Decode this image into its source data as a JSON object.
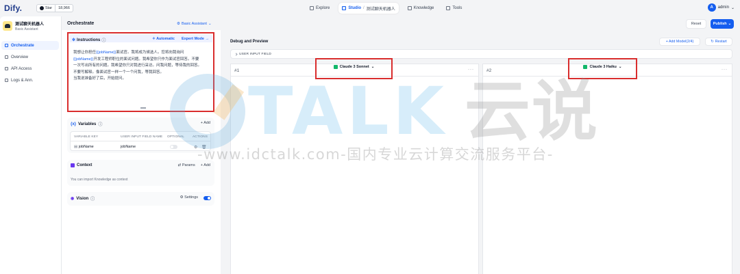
{
  "nav": {
    "logo": "Dify.",
    "github_star": "Star",
    "github_count": "18,966",
    "explore": "Explore",
    "studio": "Studio",
    "studio_separator": "/",
    "studio_app": "测试聊天机器人",
    "knowledge": "Knowledge",
    "tools": "Tools",
    "user_initial": "A",
    "user_name": "admin"
  },
  "sidebar": {
    "app_title": "测试聊天机器人",
    "app_subtitle": "Basic Assistant",
    "items": [
      {
        "label": "Orchestrate",
        "active": true
      },
      {
        "label": "Overview",
        "active": false
      },
      {
        "label": "API Access",
        "active": false
      },
      {
        "label": "Logs & Ann.",
        "active": false
      }
    ]
  },
  "orchestrate": {
    "title": "Orchestrate",
    "assistant_type": "Basic Assistant"
  },
  "header_actions": {
    "reset": "Reset",
    "publish": "Publish"
  },
  "instructions": {
    "title": "Instructions",
    "automatic": "Automatic",
    "expert_mode": "Expert Mode",
    "line1_pre": "我想让你担任",
    "line1_var": "{{jobName}}",
    "line1_post": "面试官。我将成为候选人。您将向我询问",
    "line2_var": "{{jobName}}",
    "line2_post": "开发工程师职位的面试问题。我希望你只作为面试官回答。不要",
    "line3": "一次写出所有的问题。我希望你只对我进行采访。问我问题，等待我的回答。",
    "line4": "不要写解释。像面试官一样一个一个问我，等我回答。",
    "line5": "当我说准备好了后，开始提问。"
  },
  "variables": {
    "title": "Variables",
    "add": "+ Add",
    "columns": [
      "VARIABLE KEY",
      "USER INPUT FIELD NAME",
      "OPTIONAL",
      "ACTIONS"
    ],
    "rows": [
      {
        "key": "jobName",
        "name": "jobName",
        "optional": false
      }
    ]
  },
  "context": {
    "title": "Context",
    "params": "Params",
    "add": "+ Add",
    "description": "You can import Knowledge as context"
  },
  "vision": {
    "title": "Vision",
    "settings": "Settings",
    "enabled": true
  },
  "debug": {
    "title": "Debug and Preview",
    "add_model": "+ Add Model(2/4)",
    "restart": "Restart",
    "user_input_field": "USER INPUT FIELD",
    "panels": [
      {
        "number": "#1",
        "model": "Claude 3 Sonnet"
      },
      {
        "number": "#2",
        "model": "Claude 3 Haiku"
      }
    ]
  },
  "watermark": {
    "brand_latin": "TALK",
    "brand_cn": "云说",
    "tagline": "-www.idctalk.com-国内专业云计算交流服务平台-"
  },
  "colors": {
    "accent": "#155eef",
    "highlight_box": "#d92d2d",
    "claude_icon": "#12b76a",
    "vision_icon": "#6938ef"
  }
}
